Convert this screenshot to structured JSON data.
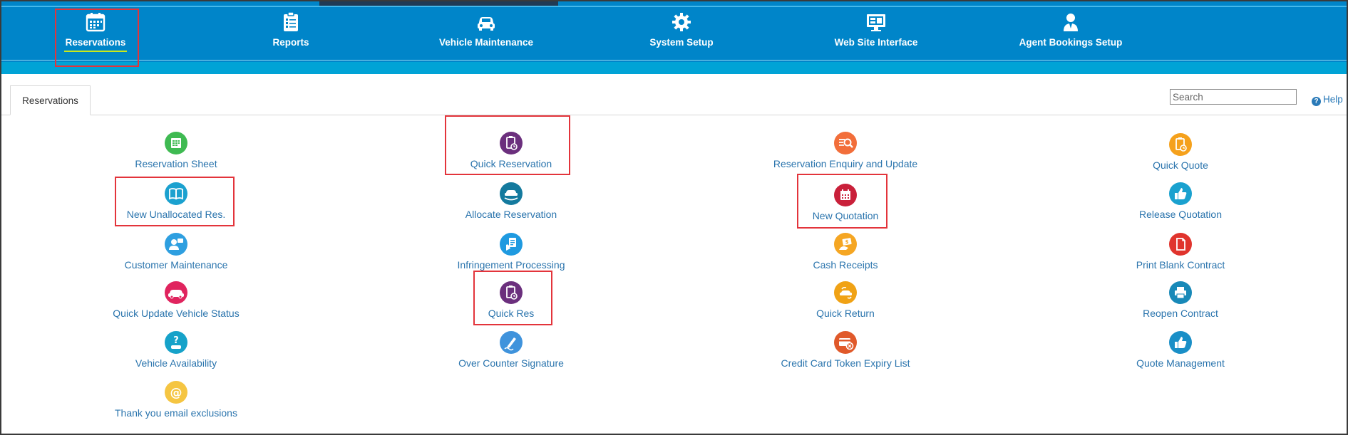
{
  "nav": {
    "items": [
      {
        "label": "Reservations",
        "icon": "calendar-icon",
        "active": true
      },
      {
        "label": "Reports",
        "icon": "clipboard-list-icon"
      },
      {
        "label": "Vehicle Maintenance",
        "icon": "car-icon"
      },
      {
        "label": "System Setup",
        "icon": "gear-icon"
      },
      {
        "label": "Web Site Interface",
        "icon": "monitor-icon"
      },
      {
        "label": "Agent Bookings Setup",
        "icon": "agent-icon"
      }
    ]
  },
  "tabs": {
    "active_label": "Reservations"
  },
  "search": {
    "placeholder": "Search"
  },
  "help": {
    "label": "Help"
  },
  "grid": {
    "col1": [
      {
        "label": "Reservation Sheet",
        "icon": "sheet-icon",
        "color": "#3fba52"
      },
      {
        "label": "New Unallocated Res.",
        "icon": "book-icon",
        "color": "#1ba1cf"
      },
      {
        "label": "Customer Maintenance",
        "icon": "person-icon",
        "color": "#2e9fe0"
      },
      {
        "label": "Quick Update Vehicle Status",
        "icon": "car-icon",
        "color": "#e0245e"
      },
      {
        "label": "Vehicle Availability",
        "icon": "question-car-icon",
        "color": "#16a2c9"
      },
      {
        "label": "Thank you email exclusions",
        "icon": "at-icon",
        "color": "#f5c542"
      }
    ],
    "col2": [
      {
        "label": "Quick Reservation",
        "icon": "clipboard-clock-icon",
        "color": "#6b2f7d"
      },
      {
        "label": "Allocate Reservation",
        "icon": "car-swap-icon",
        "color": "#147a9e"
      },
      {
        "label": "Infringement Processing",
        "icon": "document-hand-icon",
        "color": "#1f9ae0"
      },
      {
        "label": "Quick Res",
        "icon": "clipboard-clock-icon",
        "color": "#6b2f7d"
      },
      {
        "label": "Over Counter Signature",
        "icon": "pen-icon",
        "color": "#3f93dc"
      }
    ],
    "col3": [
      {
        "label": "Reservation Enquiry and Update",
        "icon": "search-list-icon",
        "color": "#f26e3a"
      },
      {
        "label": "New Quotation",
        "icon": "calendar-icon",
        "color": "#c9203a"
      },
      {
        "label": "Cash Receipts",
        "icon": "receipt-hand-icon",
        "color": "#f5a623"
      },
      {
        "label": "Quick Return",
        "icon": "car-return-icon",
        "color": "#f0a215"
      },
      {
        "label": "Credit Card Token Expiry List",
        "icon": "card-x-icon",
        "color": "#e0592a"
      }
    ],
    "col4": [
      {
        "label": "Quick Quote",
        "icon": "clipboard-clock-icon",
        "color": "#f5a11c"
      },
      {
        "label": "Release Quotation",
        "icon": "thumbs-up-icon",
        "color": "#1aa1cf"
      },
      {
        "label": "Print Blank Contract",
        "icon": "document-icon",
        "color": "#e0342d"
      },
      {
        "label": "Reopen Contract",
        "icon": "printer-icon",
        "color": "#1889b8"
      },
      {
        "label": "Quote Management",
        "icon": "thumbs-up-icon",
        "color": "#1a8fc7"
      }
    ]
  }
}
